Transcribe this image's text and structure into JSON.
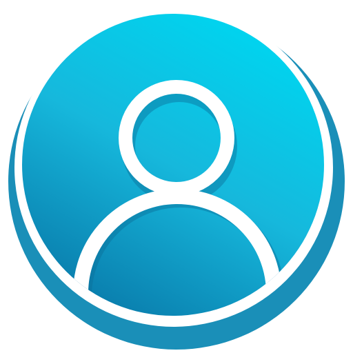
{
  "icon": {
    "name": "user-avatar-icon",
    "colors": {
      "background": "#ffffff",
      "rim": "#1a8fb8",
      "rim_dark": "#147aa0",
      "face_light": "#00d4ef",
      "face_mid": "#16b8dc",
      "face_dark": "#0a7fae",
      "outline": "#ffffff"
    }
  }
}
